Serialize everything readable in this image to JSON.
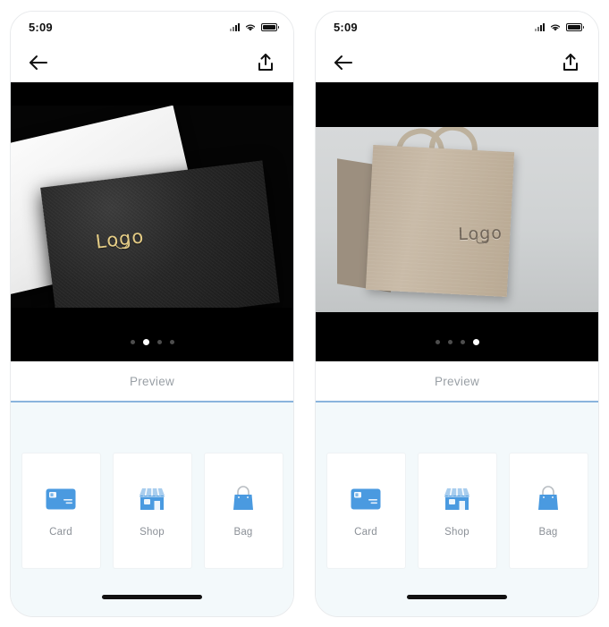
{
  "meta": {
    "screens": 2,
    "accent_blue": "#8ab4dd",
    "icon_blue": "#4a9ae0",
    "panel_bg": "#f3f9fb",
    "logo_gold": "#e8cf86"
  },
  "screens": [
    {
      "status": {
        "time": "5:09",
        "signal_icon": "cellular-signal-icon",
        "wifi_icon": "wifi-icon",
        "battery_icon": "battery-full-icon"
      },
      "nav": {
        "back_icon": "back-arrow-icon",
        "share_icon": "share-upload-icon"
      },
      "media": {
        "scene": "black-letterpress-card",
        "logo_text": "Logo",
        "dots_total": 4,
        "dot_active_index": 1
      },
      "preview": {
        "label": "Preview"
      },
      "tiles": [
        {
          "label": "Card",
          "icon": "credit-card-icon"
        },
        {
          "label": "Shop",
          "icon": "storefront-icon"
        },
        {
          "label": "Bag",
          "icon": "shopping-bag-icon"
        }
      ]
    },
    {
      "status": {
        "time": "5:09",
        "signal_icon": "cellular-signal-icon",
        "wifi_icon": "wifi-icon",
        "battery_icon": "battery-full-icon"
      },
      "nav": {
        "back_icon": "back-arrow-icon",
        "share_icon": "share-upload-icon"
      },
      "media": {
        "scene": "kraft-paper-bag",
        "logo_text": "Logo",
        "dots_total": 4,
        "dot_active_index": 3
      },
      "preview": {
        "label": "Preview"
      },
      "tiles": [
        {
          "label": "Card",
          "icon": "credit-card-icon"
        },
        {
          "label": "Shop",
          "icon": "storefront-icon"
        },
        {
          "label": "Bag",
          "icon": "shopping-bag-icon"
        }
      ]
    }
  ]
}
